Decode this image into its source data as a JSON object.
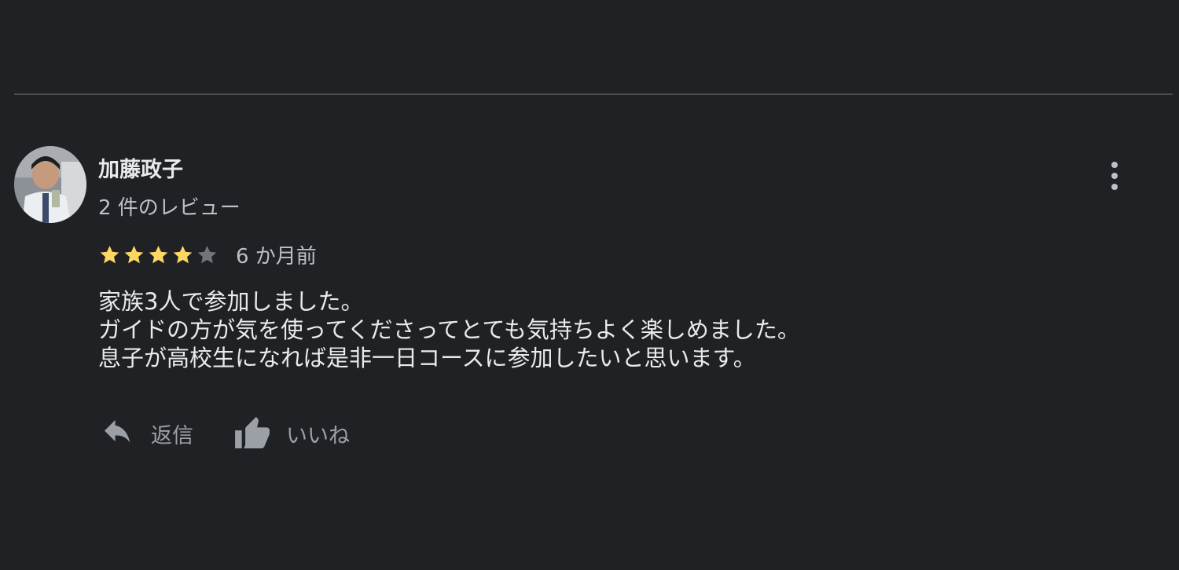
{
  "review": {
    "author": {
      "name": "加藤政子",
      "review_count_text": "2 件のレビュー"
    },
    "rating": {
      "value": 4,
      "max": 5,
      "filled_color": "#fdd663",
      "empty_color": "#70757a"
    },
    "date_text": "6 か月前",
    "text_lines": [
      "家族3人で参加しました。",
      "ガイドの方が気を使ってくださってとても気持ちよく楽しめました。",
      "息子が高校生になれば是非一日コースに参加したいと思います。"
    ],
    "actions": {
      "reply_label": "返信",
      "like_label": "いいね"
    },
    "icons": {
      "more": "more-vert-icon",
      "reply": "reply-icon",
      "like": "thumb-up-icon",
      "star": "star-icon"
    }
  }
}
